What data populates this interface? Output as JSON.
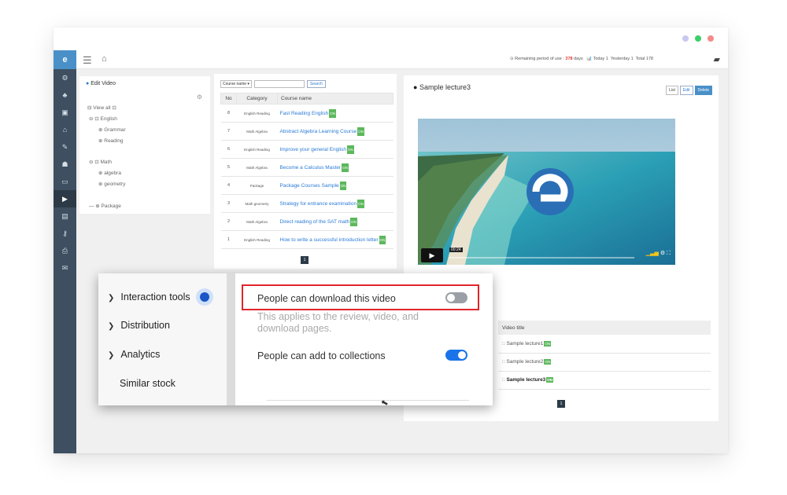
{
  "colors": {
    "accent": "#4a90c8",
    "sidebar": "#3d4f60",
    "on_badge": "#5cb85c",
    "highlight": "#e0252b",
    "toggle_on": "#1a73e8",
    "dot_purple": "#c8c8f0",
    "dot_green": "#3ccf6a",
    "dot_red": "#f58a8a"
  },
  "sidebar": {
    "logo": "e",
    "icons": [
      "gear-icon",
      "sitemap-icon",
      "image-icon",
      "home-icon",
      "pencil-icon",
      "users-icon",
      "folder-icon",
      "video-icon",
      "bus-icon",
      "key-icon",
      "printer-icon",
      "mail-icon"
    ]
  },
  "topbar": {
    "remaining_label": "⊙ Remaining period of use : ",
    "remaining_value": "378",
    "remaining_unit": " days",
    "today": "📊 Today 1",
    "yesterday": "Yesterday 1",
    "total": "Total 178"
  },
  "tree": {
    "title": "Edit Video",
    "items": [
      "⊟ View all ⊡",
      "⊖ ⊡ English",
      "⊕ Grammar",
      "⊕ Reading",
      "⊖ ⊡ Math",
      "⊕ algebra",
      "⊕ geometry",
      "— ⊕ Package"
    ]
  },
  "course_list": {
    "select_label": "Course name ▾",
    "search_label": "Search",
    "headers": [
      "No",
      "Category",
      "Course name"
    ],
    "rows": [
      {
        "no": "8",
        "category": "English Reading",
        "name": "Fast Reading English"
      },
      {
        "no": "7",
        "category": "Math Algebra",
        "name": "Abstract Algebra Learning Course"
      },
      {
        "no": "6",
        "category": "English Reading",
        "name": "Improve your general English"
      },
      {
        "no": "5",
        "category": "Math Algebra",
        "name": "Become a Calculus Master"
      },
      {
        "no": "4",
        "category": "Package",
        "name": "Package Courses Sample"
      },
      {
        "no": "3",
        "category": "Math geometry",
        "name": "Strategy for entrance examination"
      },
      {
        "no": "2",
        "category": "Math Algebra",
        "name": "Direct reading of the SAT math"
      },
      {
        "no": "1",
        "category": "English Reading",
        "name": "How to write a successful introduction letter"
      }
    ],
    "on_label": "ON",
    "page": "1"
  },
  "video": {
    "title": "Sample lecture3",
    "list_btn": "List",
    "edit_btn": "Edit",
    "delete_btn": "Delete",
    "time": "00:24",
    "table_header": "Video title",
    "rows": [
      "Sample lecture1",
      "Sample lecture2",
      "Sample lecture3"
    ],
    "row_prefix": "□",
    "page": "1"
  },
  "overlay": {
    "menu": [
      "Interaction tools",
      "Distribution",
      "Analytics",
      "Similar stock"
    ],
    "download_label": "People can download this video",
    "download_enabled": false,
    "download_desc": "This applies to the review, video, and download pages.",
    "collections_label": "People can add to collections",
    "collections_enabled": true
  }
}
